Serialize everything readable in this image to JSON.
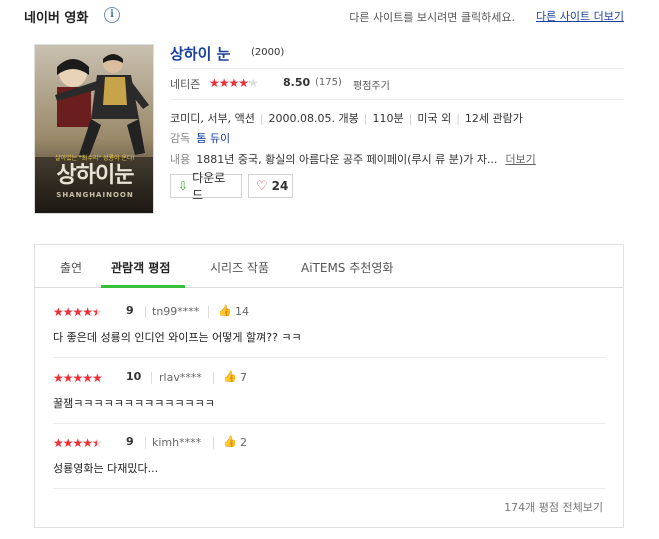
{
  "header": {
    "title": "네이버 영화",
    "info_icon": "i",
    "hint": "다른 사이트를 보시려면 클릭하세요.",
    "link": "다른 사이트 더보기"
  },
  "movie": {
    "title": "상하이 눈",
    "year": "(2000)",
    "poster": {
      "tagline": "살아있는 \"최수리\" 성룡이 온다!",
      "title": "상하이눈",
      "subtitle": "SHANGHAINOON"
    },
    "rating": {
      "label": "네티즌",
      "score": "8.50",
      "fill_percent": 85,
      "count": "(175)",
      "rate_link": "평점주기"
    },
    "meta": [
      "코미디, 서부, 액션",
      "2000.08.05. 개봉",
      "110분",
      "미국 외",
      "12세 관람가"
    ],
    "director_label": "감독",
    "director": "톰 듀이",
    "summary_label": "내용",
    "summary": "1881년 중국, 황실의 아름다운 공주 페이페이(루시 류 분)가 자...",
    "more_link": "더보기",
    "download_label": "다운로드",
    "like_count": "24"
  },
  "tabs": [
    "출연",
    "관람객 평점",
    "시리즈 작품",
    "AiTEMS 추천영화"
  ],
  "active_tab": 1,
  "reviews": [
    {
      "score": "9",
      "fill_percent": 90,
      "user": "tn99****",
      "likes": "14",
      "text": "다 좋은데 성룡의 인디언 와이프는 어떻게 할껴?? ㅋㅋ"
    },
    {
      "score": "10",
      "fill_percent": 100,
      "user": "rlav****",
      "likes": "7",
      "text": "꿀잼ㅋㅋㅋㅋㅋㅋㅋㅋㅋㅋㅋㅋㅋㅋ"
    },
    {
      "score": "9",
      "fill_percent": 90,
      "user": "kimh****",
      "likes": "2",
      "text": "성룡영화는 다재밌다..."
    }
  ],
  "view_all": "174개 평점 전체보기",
  "colors": {
    "accent_green": "#37c13a",
    "star_red": "#ef2e36",
    "link_blue": "#1a3f9e"
  }
}
